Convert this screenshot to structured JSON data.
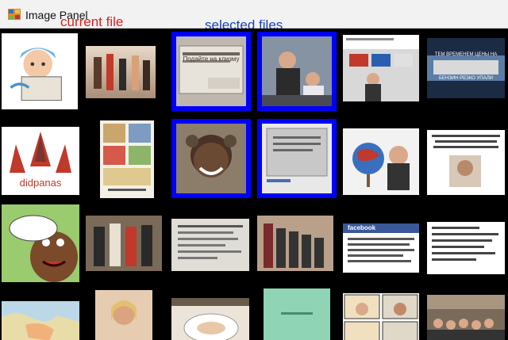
{
  "window": {
    "title": "Image Panel",
    "icon": "image-panel-app-icon"
  },
  "annotations": [
    {
      "text": "current file",
      "color": "#e0201a"
    },
    {
      "text": "selected files",
      "color": "#1a3fc0"
    }
  ],
  "colors": {
    "current_border": "#e54b2e",
    "selected_border": "#0000ff",
    "background": "#000000"
  },
  "thumbnails": [
    {
      "row": 1,
      "col": 1,
      "state": "current",
      "depicts": "cartoon child in bed",
      "caption": ""
    },
    {
      "row": 1,
      "col": 2,
      "state": "normal",
      "depicts": "people dancing in a room",
      "caption": ""
    },
    {
      "row": 1,
      "col": 3,
      "state": "selected",
      "depicts": "photo of a sign",
      "caption": "Подайте на клизму"
    },
    {
      "row": 1,
      "col": 4,
      "state": "selected",
      "depicts": "man signing at podium",
      "caption": ""
    },
    {
      "row": 1,
      "col": 5,
      "state": "normal",
      "depicts": "man in office with flags",
      "caption": ""
    },
    {
      "row": 1,
      "col": 6,
      "state": "normal",
      "depicts": "fuel price meme",
      "caption": "ТЕМ ВРЕМЕНЕМ ЦЕНЫ НА БЕНЗИН РЕЗКО УПАЛИ"
    },
    {
      "row": 2,
      "col": 1,
      "state": "normal",
      "depicts": "embroidered logo parody",
      "caption": "didpanas"
    },
    {
      "row": 2,
      "col": 2,
      "state": "normal",
      "depicts": "comic strip",
      "caption": ""
    },
    {
      "row": 2,
      "col": 3,
      "state": "selected",
      "depicts": "smiling woman with curlers",
      "caption": ""
    },
    {
      "row": 2,
      "col": 4,
      "state": "selected",
      "depicts": "memorial plaque",
      "caption": ""
    },
    {
      "row": 2,
      "col": 5,
      "state": "normal",
      "depicts": "caricature with globe",
      "caption": ""
    },
    {
      "row": 2,
      "col": 6,
      "state": "normal",
      "depicts": "text meme with portrait",
      "caption": ""
    },
    {
      "row": 3,
      "col": 1,
      "state": "normal",
      "depicts": "cartoon bear with speech bubble",
      "caption": ""
    },
    {
      "row": 3,
      "col": 2,
      "state": "normal",
      "depicts": "group of clergy",
      "caption": ""
    },
    {
      "row": 3,
      "col": 3,
      "state": "normal",
      "depicts": "scanned document",
      "caption": ""
    },
    {
      "row": 3,
      "col": 4,
      "state": "normal",
      "depicts": "line of people",
      "caption": ""
    },
    {
      "row": 3,
      "col": 5,
      "state": "normal",
      "depicts": "social media post",
      "caption": "facebook"
    },
    {
      "row": 3,
      "col": 6,
      "state": "normal",
      "depicts": "multilingual text list",
      "caption": ""
    },
    {
      "row": 4,
      "col": 1,
      "state": "normal",
      "depicts": "map",
      "caption": ""
    },
    {
      "row": 4,
      "col": 2,
      "state": "normal",
      "depicts": "woman portrait",
      "caption": ""
    },
    {
      "row": 4,
      "col": 3,
      "state": "normal",
      "depicts": "food plate with banner",
      "caption": ""
    },
    {
      "row": 4,
      "col": 4,
      "state": "normal",
      "depicts": "green document",
      "caption": ""
    },
    {
      "row": 4,
      "col": 5,
      "state": "normal",
      "depicts": "comic meme",
      "caption": ""
    },
    {
      "row": 4,
      "col": 6,
      "state": "normal",
      "depicts": "crowd photo",
      "caption": ""
    }
  ]
}
